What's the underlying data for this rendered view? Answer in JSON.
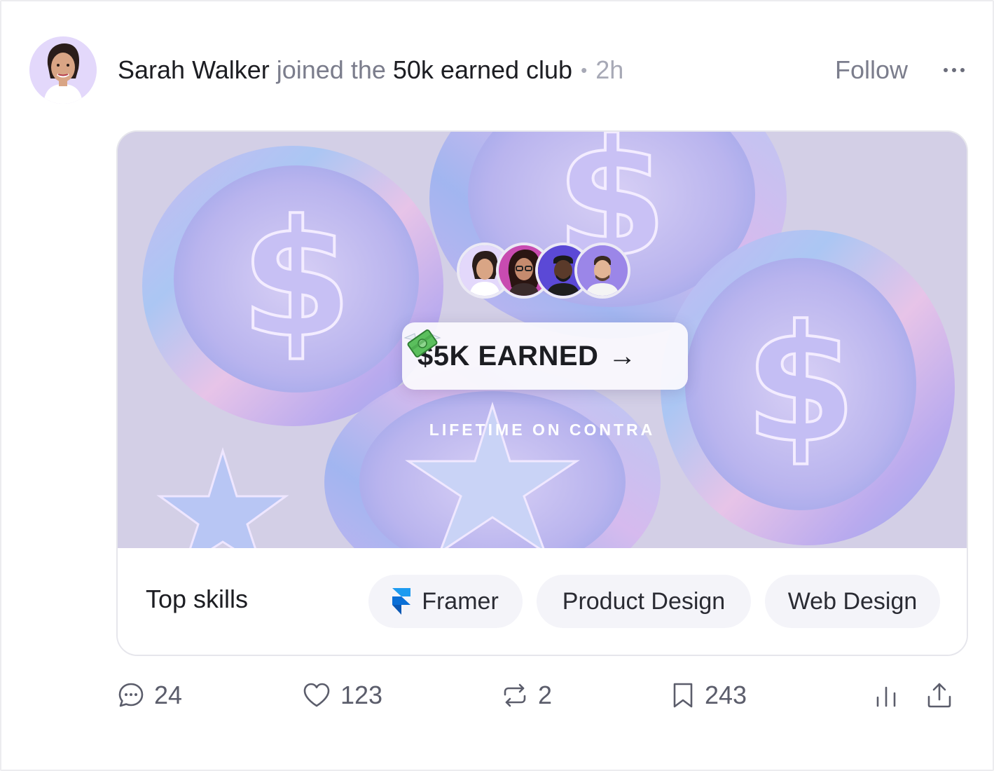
{
  "post": {
    "author": "Sarah Walker",
    "action_text": "joined the",
    "club": "50k earned club",
    "separator": "•",
    "time": "2h",
    "follow_label": "Follow",
    "more_label": "···"
  },
  "card": {
    "earned_label": "$5K EARNED",
    "arrow": "→",
    "lifetime_label": "LIFETIME ON CONTRA",
    "skills_title": "Top skills",
    "skills": [
      {
        "label": "Framer",
        "icon": "framer-icon"
      },
      {
        "label": "Product Design"
      },
      {
        "label": "Web Design"
      }
    ]
  },
  "actions": {
    "comments": "24",
    "likes": "123",
    "reposts": "2",
    "bookmarks": "243"
  },
  "colors": {
    "accent_purple": "#c9bff2",
    "muted_text": "#7b7d8c",
    "chip_bg": "#f4f4f9"
  }
}
